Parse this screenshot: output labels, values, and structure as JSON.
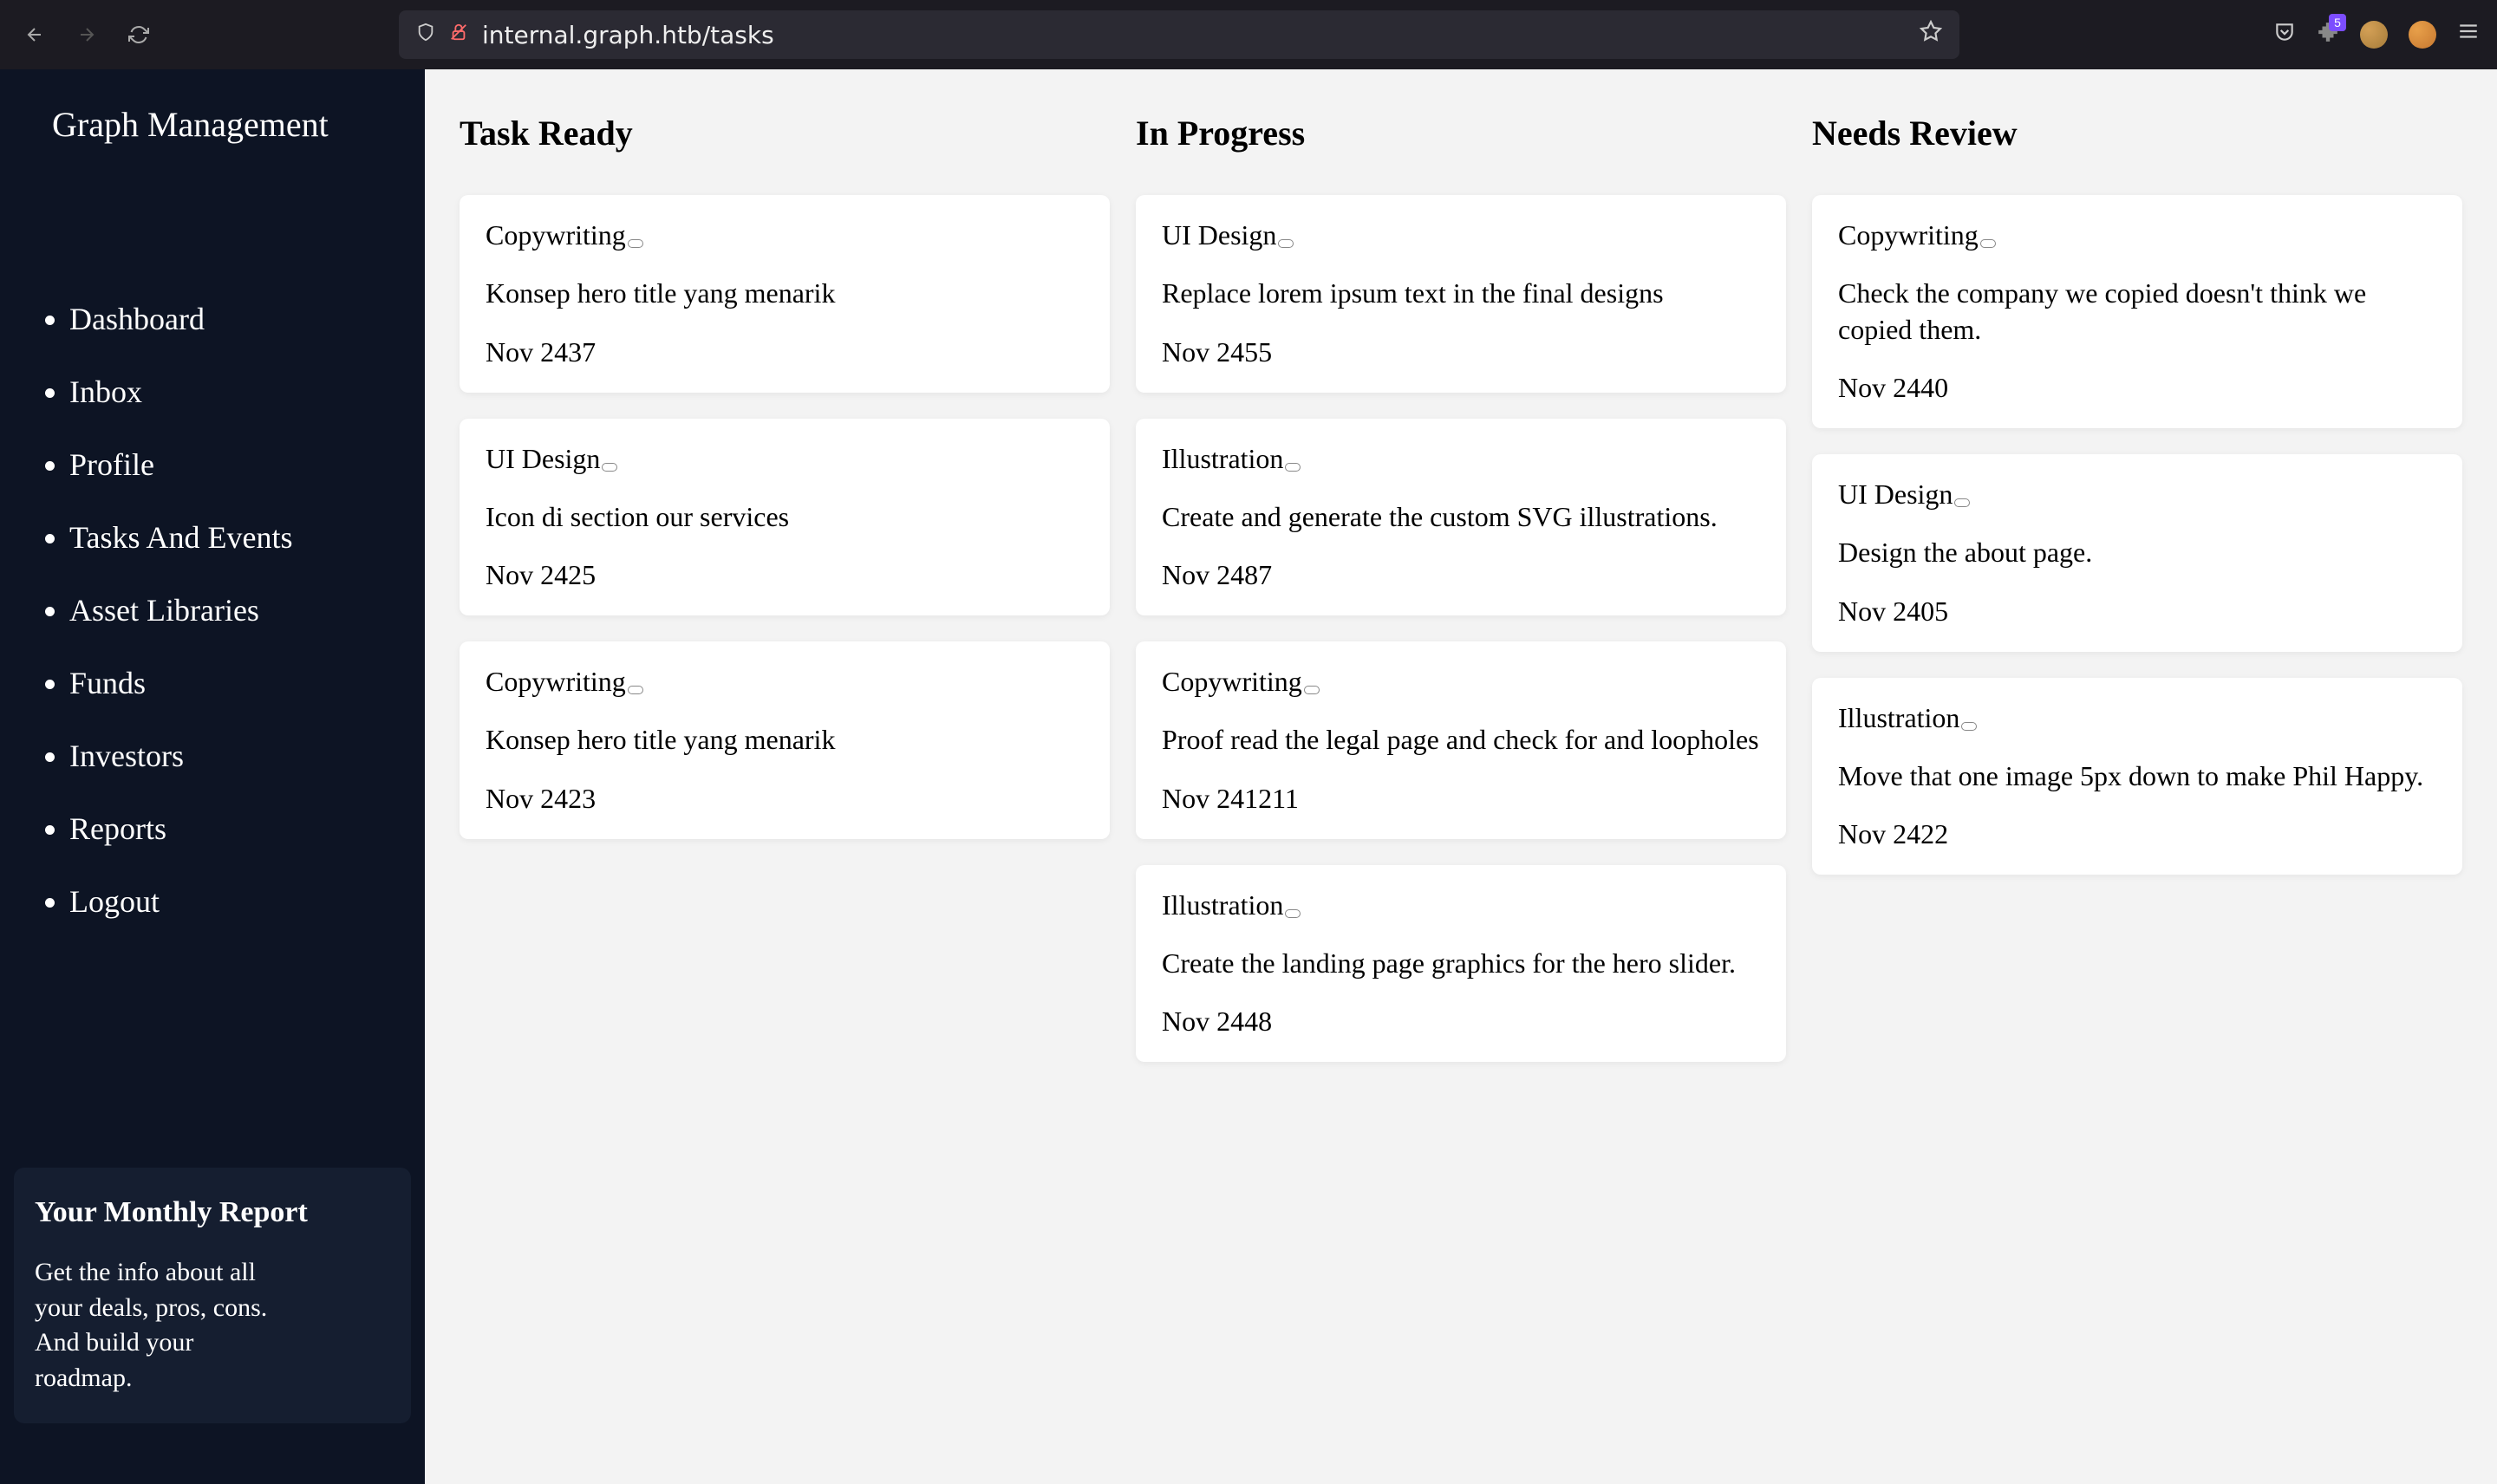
{
  "browser": {
    "url": "internal.graph.htb/tasks",
    "extension_badge": "5"
  },
  "sidebar": {
    "app_title": "Graph Management",
    "nav": [
      "Dashboard",
      "Inbox",
      "Profile",
      "Tasks And Events",
      "Asset Libraries",
      "Funds",
      "Investors",
      "Reports",
      "Logout"
    ],
    "report": {
      "title": "Your Monthly Report",
      "desc": "Get the info about all your deals, pros, cons. And build your roadmap."
    }
  },
  "board": {
    "columns": [
      {
        "title": "Task Ready",
        "cards": [
          {
            "tag": "Copywriting",
            "desc": "Konsep hero title yang menarik",
            "date": "Nov 2437"
          },
          {
            "tag": "UI Design",
            "desc": "Icon di section our services",
            "date": "Nov 2425"
          },
          {
            "tag": "Copywriting",
            "desc": "Konsep hero title yang menarik",
            "date": "Nov 2423"
          }
        ]
      },
      {
        "title": "In Progress",
        "cards": [
          {
            "tag": "UI Design",
            "desc": "Replace lorem ipsum text in the final designs",
            "date": "Nov 2455"
          },
          {
            "tag": "Illustration",
            "desc": "Create and generate the custom SVG illustrations.",
            "date": "Nov 2487"
          },
          {
            "tag": "Copywriting",
            "desc": "Proof read the legal page and check for and loopholes",
            "date": "Nov 241211"
          },
          {
            "tag": "Illustration",
            "desc": "Create the landing page graphics for the hero slider.",
            "date": "Nov 2448"
          }
        ]
      },
      {
        "title": "Needs Review",
        "cards": [
          {
            "tag": "Copywriting",
            "desc": "Check the company we copied doesn't think we copied them.",
            "date": "Nov 2440"
          },
          {
            "tag": "UI Design",
            "desc": "Design the about page.",
            "date": "Nov 2405"
          },
          {
            "tag": "Illustration",
            "desc": "Move that one image 5px down to make Phil Happy.",
            "date": "Nov 2422"
          }
        ]
      }
    ]
  }
}
